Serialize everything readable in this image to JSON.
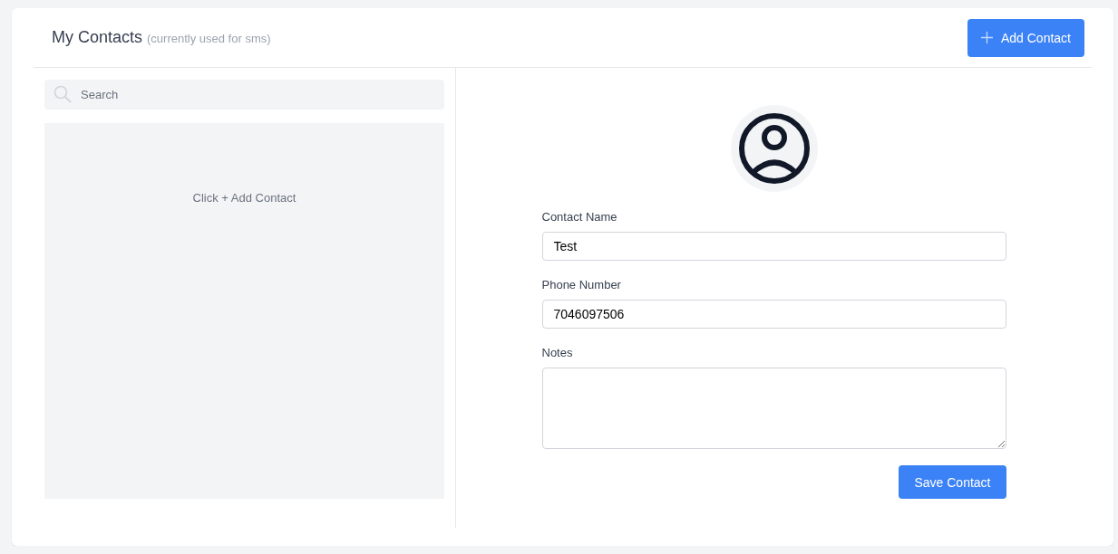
{
  "header": {
    "title": "My Contacts",
    "subtitle": "(currently used for sms)",
    "add_button": "Add Contact"
  },
  "search": {
    "placeholder": "Search"
  },
  "contact_list": {
    "empty_message": "Click + Add Contact"
  },
  "form": {
    "fields": [
      {
        "kind": "input",
        "label": "Contact Name",
        "value": "Test"
      },
      {
        "kind": "input",
        "label": "Phone Number",
        "value": "7046097506"
      },
      {
        "kind": "textarea",
        "label": "Notes"
      }
    ],
    "save_button": "Save Contact"
  }
}
